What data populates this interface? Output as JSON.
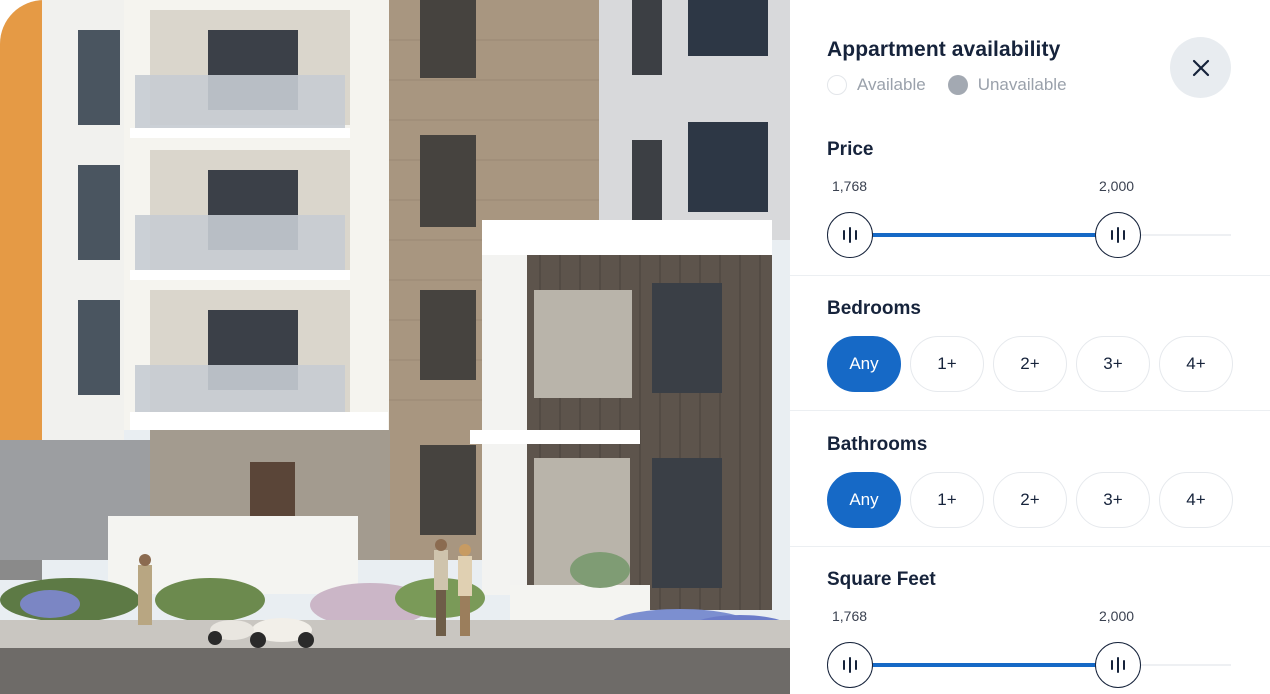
{
  "panel": {
    "title": "Appartment availability",
    "legend": {
      "available": "Available",
      "unavailable": "Unavailable"
    },
    "close_icon": "close-icon"
  },
  "price": {
    "title": "Price",
    "min_label": "1,768",
    "max_label": "2,000",
    "low_fraction": 0.0,
    "high_fraction": 0.67
  },
  "bedrooms": {
    "title": "Bedrooms",
    "options": [
      "Any",
      "1+",
      "2+",
      "3+",
      "4+"
    ],
    "selected": "Any"
  },
  "bathrooms": {
    "title": "Bathrooms",
    "options": [
      "Any",
      "1+",
      "2+",
      "3+",
      "4+"
    ],
    "selected": "Any"
  },
  "square_feet": {
    "title": "Square Feet",
    "min_label": "1,768",
    "max_label": "2,000",
    "low_fraction": 0.0,
    "high_fraction": 0.67
  },
  "colors": {
    "accent": "#1669c6",
    "text_dark": "#16233b",
    "muted": "#9aa1ab"
  }
}
